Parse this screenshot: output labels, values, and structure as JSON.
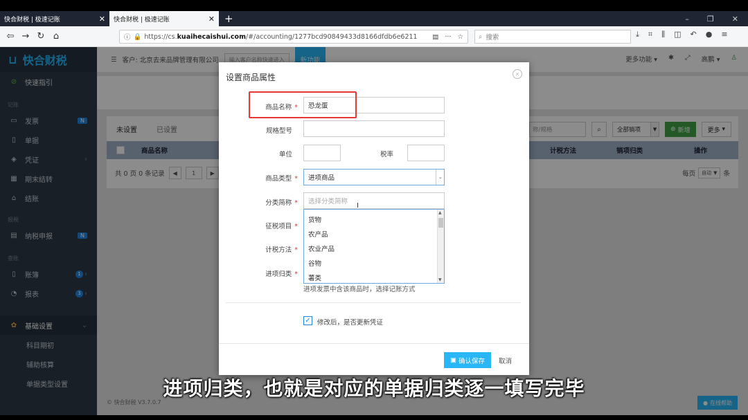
{
  "browser": {
    "tabs": [
      {
        "label": "快合财税 | 极速记账"
      },
      {
        "label": "快合财税 | 极速记账"
      }
    ],
    "url_prefix": "https://cs.",
    "url_host": "kuaihecaishui.com",
    "url_path": "/#/accounting/1277bcd90849433d8166dfdb6e6211",
    "search_placeholder": "搜索"
  },
  "app": {
    "logo": "快合财税",
    "header": {
      "customer_label": "客户: 北京去来品牌管理有限公司",
      "customer_input_placeholder": "输入客户名称快速进入",
      "new_feature": "新功能",
      "more_functions": "更多功能",
      "user": "高鹏"
    },
    "sidebar": {
      "guide": "快速指引",
      "section_record": "记账",
      "items": [
        {
          "label": "发票",
          "badge": "N"
        },
        {
          "label": "单据"
        },
        {
          "label": "凭证"
        },
        {
          "label": "期末结转"
        },
        {
          "label": "结账"
        }
      ],
      "section_tax": "报税",
      "tax_item": {
        "label": "纳税申报",
        "badge": "N"
      },
      "section_query": "查账",
      "query_items": [
        {
          "label": "账簿",
          "badge": "1"
        },
        {
          "label": "报表",
          "badge": "3"
        }
      ],
      "settings": "基础设置",
      "settings_sub": [
        "科目期初",
        "辅助核算",
        "单据类型设置"
      ]
    },
    "panel": {
      "tab_unset": "未设置",
      "tab_set": "已设置",
      "search_placeholder": "称/规格",
      "filter_select": "全部销项",
      "add_button": "新增",
      "more_button": "更多",
      "columns": {
        "name": "商品名称",
        "tax_method": "计税方法",
        "sales_class": "销项归类",
        "action": "操作"
      },
      "pager_text": "共 0 页 0 条记录",
      "page_num": "1",
      "per_page_label": "每页",
      "per_page_value": "自动",
      "per_page_unit": "条"
    },
    "version": "© 快合财税 V3.7.0.7",
    "help": "在线帮助"
  },
  "modal": {
    "title": "设置商品属性",
    "fields": {
      "name_label": "商品名称",
      "name_value": "恐龙蛋",
      "spec_label": "规格型号",
      "unit_label": "单位",
      "tax_rate_label": "税率",
      "type_label": "商品类型",
      "type_value": "进项商品",
      "category_label": "分类简称",
      "category_placeholder": "选择分类简称",
      "tax_item_label": "征税项目",
      "tax_method_label": "计税方法",
      "input_class_label": "进项归类"
    },
    "dropdown_options": [
      "货物",
      "农产品",
      "农业产品",
      "谷物",
      "薯类"
    ],
    "hint": "进项发票中含该商品时，选择记账方式",
    "checkbox_label": "修改后，是否更新凭证",
    "save": "确认保存",
    "cancel": "取消"
  },
  "subtitle": "进项归类，也就是对应的单据归类逐一填写完毕"
}
